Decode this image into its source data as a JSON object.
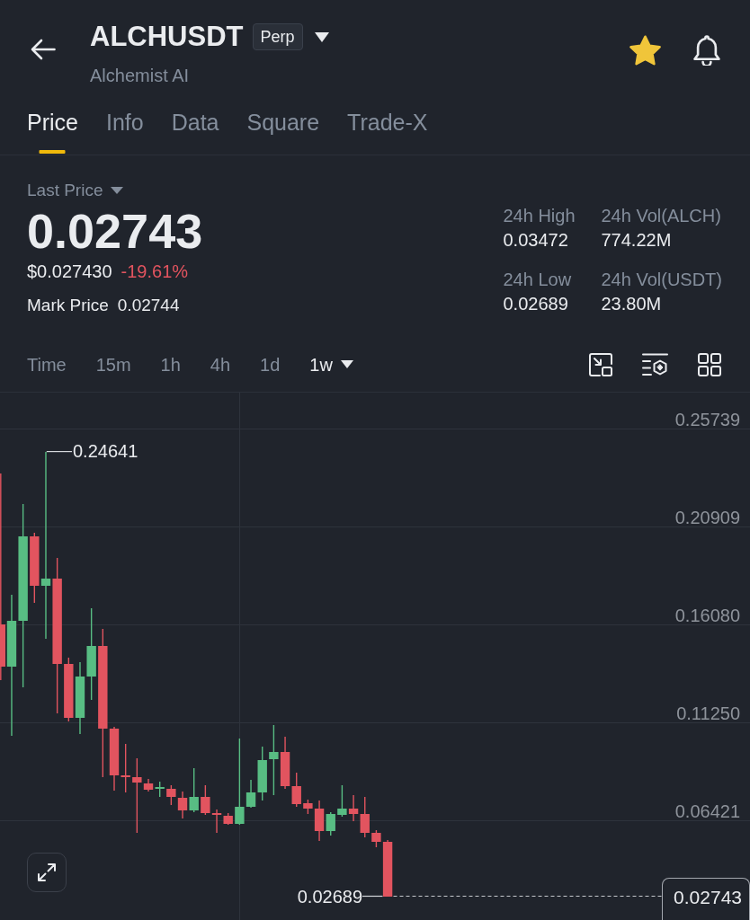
{
  "header": {
    "title": "ALCHUSDT",
    "badge": "Perp",
    "subtitle": "Alchemist AI",
    "favorite": true
  },
  "tabs": [
    {
      "label": "Price",
      "selected": true
    },
    {
      "label": "Info",
      "selected": false
    },
    {
      "label": "Data",
      "selected": false
    },
    {
      "label": "Square",
      "selected": false
    },
    {
      "label": "Trade-X",
      "selected": false
    }
  ],
  "price": {
    "selector": "Last Price",
    "last_price": "0.02743",
    "usd_price": "$0.027430",
    "change": "-19.61%",
    "negative": true,
    "mark_label": "Mark Price",
    "mark_price": "0.02744"
  },
  "stats": [
    {
      "label": "24h High",
      "value": "0.03472"
    },
    {
      "label": "24h Vol(ALCH)",
      "value": "774.22M"
    },
    {
      "label": "24h Low",
      "value": "0.02689"
    },
    {
      "label": "24h Vol(USDT)",
      "value": "23.80M"
    }
  ],
  "intervals": [
    {
      "label": "Time",
      "selected": false,
      "dropdown": false
    },
    {
      "label": "15m",
      "selected": false,
      "dropdown": false
    },
    {
      "label": "1h",
      "selected": false,
      "dropdown": false
    },
    {
      "label": "4h",
      "selected": false,
      "dropdown": false
    },
    {
      "label": "1d",
      "selected": false,
      "dropdown": false
    },
    {
      "label": "1w",
      "selected": true,
      "dropdown": true
    }
  ],
  "chart": {
    "price_axis": [
      "0.25739",
      "0.20909",
      "0.16080",
      "0.11250",
      "0.06421"
    ],
    "high_marker": "0.24641",
    "low_marker": "0.02689",
    "last_price_tag": "0.02743"
  }
}
